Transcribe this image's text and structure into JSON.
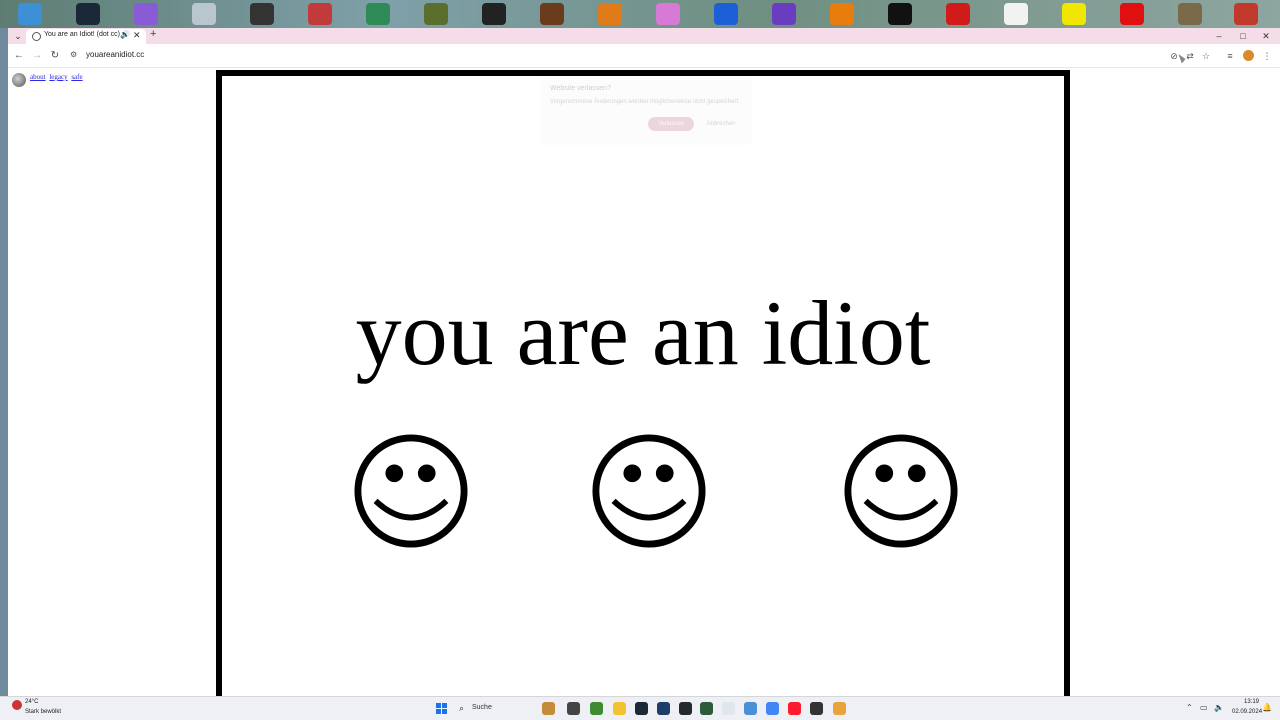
{
  "desktop_icons": [
    {
      "name": "recycle-bin-icon",
      "color": "#3d8fd6"
    },
    {
      "name": "steam-icon",
      "color": "#1b2838"
    },
    {
      "name": "fall-guys-icon",
      "color": "#8a5bd6"
    },
    {
      "name": "blank-shortcut-icon",
      "color": "#b9c6cf"
    },
    {
      "name": "puzzle-app-icon",
      "color": "#333333"
    },
    {
      "name": "roblox-icon",
      "color": "#c23a3a"
    },
    {
      "name": "craft-game-icon",
      "color": "#2e8b57"
    },
    {
      "name": "goblin-game-icon",
      "color": "#5a6e2e"
    },
    {
      "name": "gorilla-game-icon",
      "color": "#222222"
    },
    {
      "name": "fnaf-icon",
      "color": "#6b3b1e"
    },
    {
      "name": "fl-studio-icon",
      "color": "#e07b1a"
    },
    {
      "name": "axolotl-icon",
      "color": "#d67ad6"
    },
    {
      "name": "sonic-icon",
      "color": "#1d5fd6"
    },
    {
      "name": "roblox-studio-icon",
      "color": "#6a3cc0"
    },
    {
      "name": "blender-icon",
      "color": "#e87d0d"
    },
    {
      "name": "mask-game-icon",
      "color": "#111111"
    },
    {
      "name": "red-heart-icon",
      "color": "#d11a1a"
    },
    {
      "name": "ghost-icon",
      "color": "#f2f2f2"
    },
    {
      "name": "yellow-heart-icon",
      "color": "#f0e600"
    },
    {
      "name": "red-heart-2-icon",
      "color": "#e01010"
    },
    {
      "name": "creature-game-icon",
      "color": "#7a6a4a"
    },
    {
      "name": "winrar-icon",
      "color": "#c0392b"
    }
  ],
  "browser": {
    "tab_title": "You are an Idiot! (dot cc)",
    "url": "youareanidiot.cc",
    "window_controls": {
      "minimize": "–",
      "maximize": "□",
      "close": "✕"
    }
  },
  "page": {
    "links": [
      "about",
      "legacy",
      "safe"
    ],
    "headline": "you are an idiot",
    "smileys": [
      "smiley",
      "smiley",
      "smiley"
    ],
    "ghost_dialog": {
      "title": "Website verlassen?",
      "text": "Vorgenommene Änderungen werden möglicherweise nicht gespeichert.",
      "leave_label": "Verlassen",
      "cancel_label": "Abbrechen"
    }
  },
  "taskbar": {
    "weather_temp": "24°C",
    "weather_desc": "Stark bewölkt",
    "search_label": "Suche",
    "time": "13:19",
    "date": "02.09.2024",
    "apps": [
      {
        "name": "taskbar-app-1-icon",
        "color": "#c58a3a"
      },
      {
        "name": "taskbar-app-2-icon",
        "color": "#444444"
      },
      {
        "name": "minecraft-icon",
        "color": "#3c8c2f"
      },
      {
        "name": "file-explorer-icon",
        "color": "#f2c230"
      },
      {
        "name": "steam-taskbar-icon",
        "color": "#1b2838"
      },
      {
        "name": "editor-icon",
        "color": "#1f3d6b"
      },
      {
        "name": "github-icon",
        "color": "#24292e"
      },
      {
        "name": "game-launcher-icon",
        "color": "#2d5a3a"
      },
      {
        "name": "notepad-icon",
        "color": "#dfe6ee"
      },
      {
        "name": "taskbar-app-3-icon",
        "color": "#4a90d9"
      },
      {
        "name": "chrome-icon",
        "color": "#4285f4"
      },
      {
        "name": "opera-icon",
        "color": "#ff1b2d"
      },
      {
        "name": "taskbar-app-4-icon",
        "color": "#333333"
      },
      {
        "name": "chrome-active-icon",
        "color": "#e8a33d"
      }
    ]
  }
}
